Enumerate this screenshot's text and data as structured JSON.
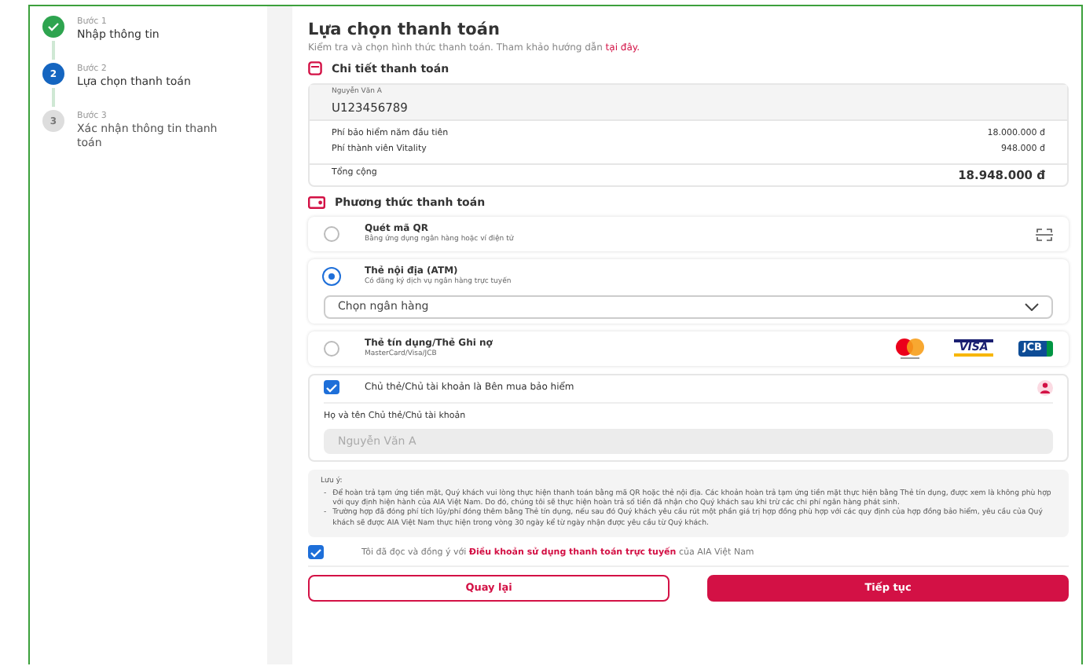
{
  "steps": [
    {
      "label": "Bước 1",
      "title": "Nhập thông tin",
      "kind": "done"
    },
    {
      "label": "Bước 2",
      "title": "Lựa chọn thanh toán",
      "kind": "current",
      "number": "2"
    },
    {
      "label": "Bước 3",
      "title": "Xác nhận thông tin thanh toán",
      "kind": "pending",
      "number": "3"
    }
  ],
  "header": {
    "title": "Lựa chọn thanh toán",
    "subtitle": "Kiểm tra và chọn hình thức thanh toán. Tham khảo hướng dẫn",
    "link": "tại đây."
  },
  "details": {
    "heading": "Chi tiết thanh toán",
    "holder_name": "Nguyễn Văn A",
    "policy_no": "U123456789",
    "lines": [
      {
        "label": "Phí bảo hiểm năm đầu tiên",
        "amount": "18.000.000 đ"
      },
      {
        "label": "Phí thành viên Vitality",
        "amount": "948.000 đ"
      }
    ],
    "total": {
      "label": "Tổng cộng",
      "amount": "18.948.000 đ"
    }
  },
  "methods_heading": "Phương thức thanh toán",
  "methods": [
    {
      "kind": "qr",
      "title": "Quét mã QR",
      "subtitle": "Bằng ứng dụng ngân hàng hoặc ví điện tử",
      "selected": false
    },
    {
      "kind": "atm",
      "title": "Thẻ nội địa (ATM)",
      "subtitle": "Có đăng ký dịch vụ ngân hàng trực tuyến",
      "selected": true,
      "select_placeholder": "Chọn ngân hàng"
    },
    {
      "kind": "card",
      "title": "Thẻ tín dụng/Thẻ Ghi nợ",
      "subtitle": "MasterCard/Visa/JCB",
      "selected": false,
      "logos": [
        {
          "kind": "mastercard"
        },
        {
          "kind": "visa",
          "text": "VISA"
        },
        {
          "kind": "jcb",
          "text": "JCB"
        }
      ]
    }
  ],
  "holder": {
    "checked": true,
    "label": "Chủ thẻ/Chủ tài khoản là Bên mua bảo hiểm",
    "field_label": "Họ và tên Chủ thẻ/Chủ tài khoản",
    "field_value": "Nguyễn Văn A",
    "disabled": true
  },
  "note": {
    "title": "Lưu ý:",
    "items": [
      {
        "marker": "-",
        "text": "Để hoàn trả tạm ứng tiền mặt, Quý khách vui lòng thực hiện thanh toán bằng mã QR hoặc thẻ nội địa. Các khoản hoàn trả tạm ứng tiền mặt thực hiện bằng Thẻ tín dụng, được xem là không phù hợp với quy định hiện hành của AIA Việt Nam. Do đó, chúng tôi sẽ thực hiện hoàn trả số tiền đã nhận cho Quý khách sau khi trừ các chi phí ngân hàng phát sinh."
      },
      {
        "marker": "-",
        "text": "Trường hợp đã đóng phí tích lũy/phí đóng thêm bằng Thẻ tín dụng, nếu sau đó Quý khách yêu cầu rút một phần giá trị hợp đồng phù hợp với các quy định của hợp đồng bảo hiểm, yêu cầu của Quý khách sẽ được AIA Việt Nam thực hiện trong vòng 30 ngày kể từ ngày nhận được yêu cầu từ Quý khách."
      }
    ]
  },
  "agree": {
    "checked": true,
    "before": "Tôi đã đọc và đồng ý với",
    "link": "Điều khoản sử dụng thanh toán trực tuyến",
    "after": "của AIA Việt Nam"
  },
  "buttons": {
    "back": "Quay lại",
    "next": "Tiếp tục"
  }
}
